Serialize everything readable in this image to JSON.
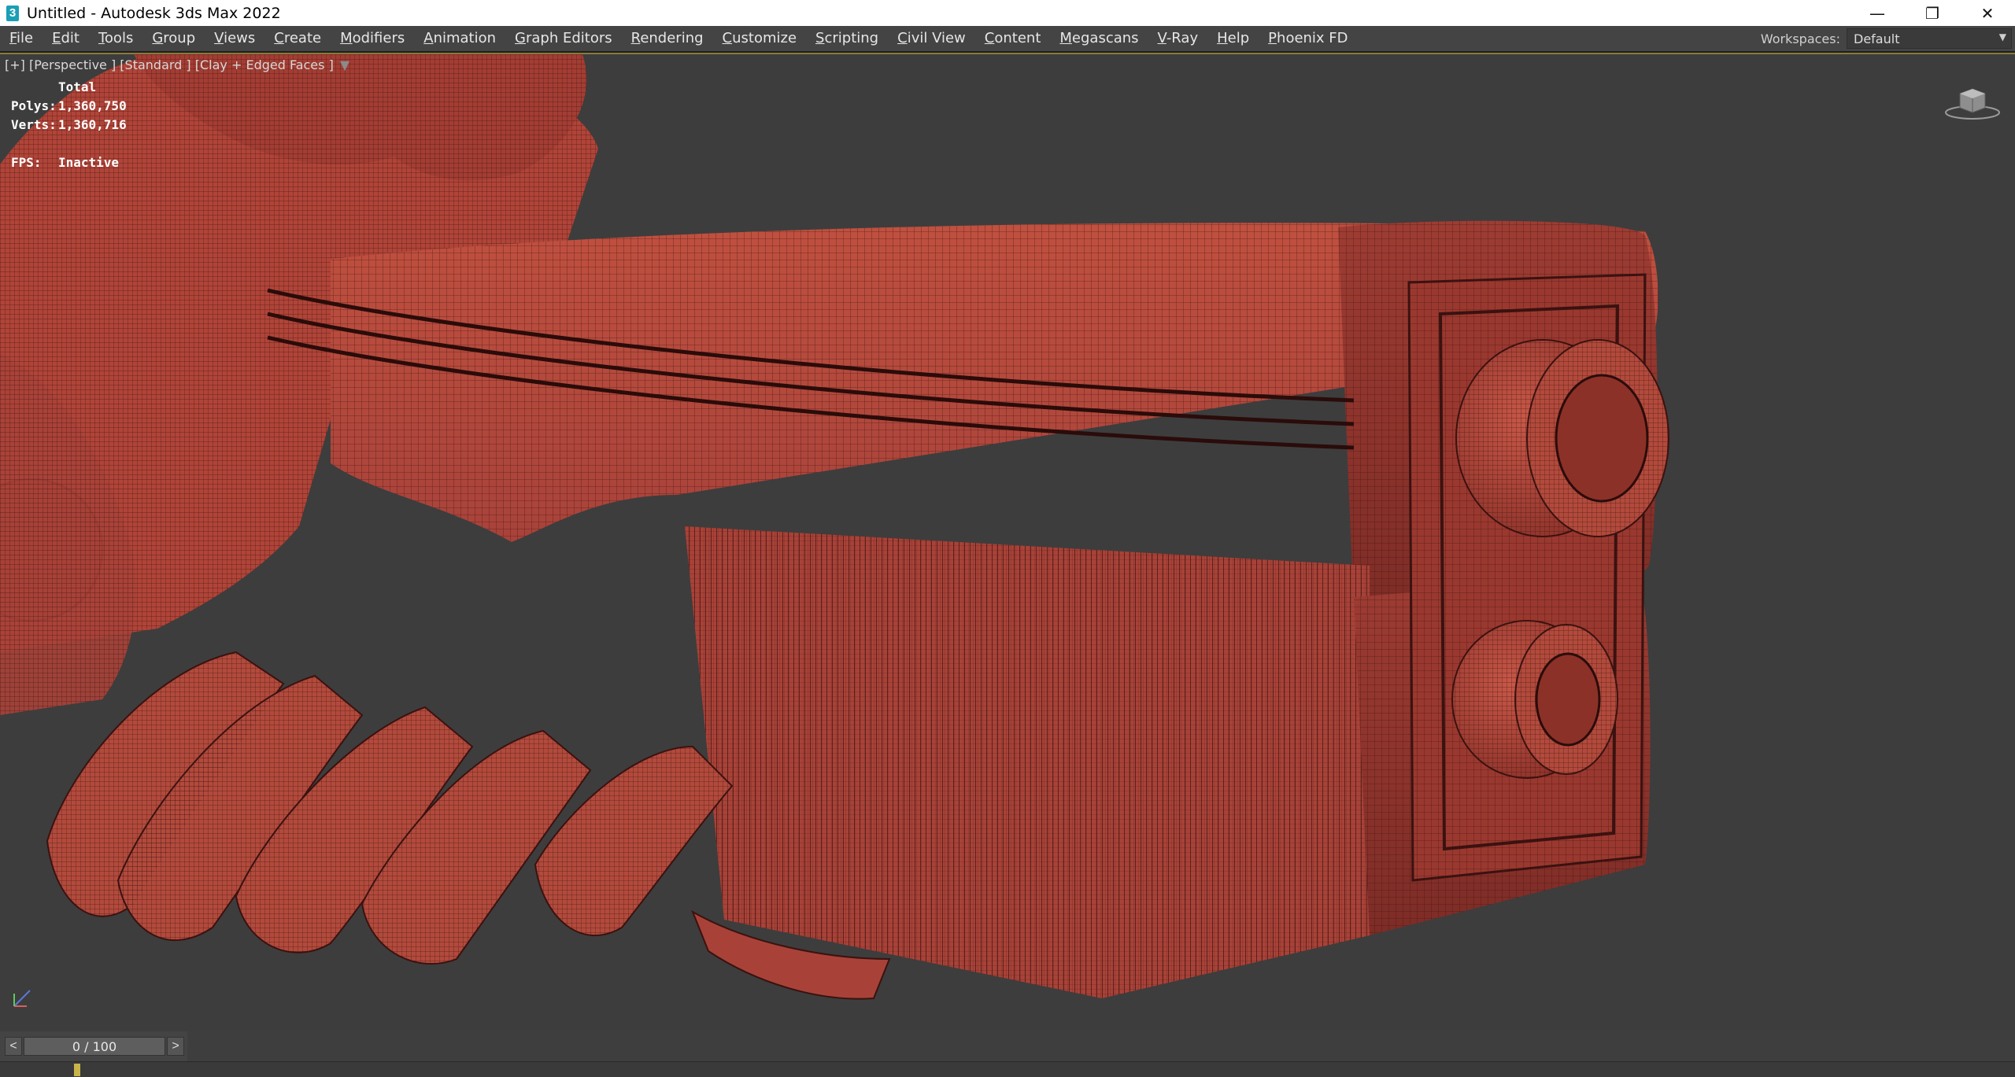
{
  "window": {
    "title": "Untitled - Autodesk 3ds Max 2022",
    "app_icon": "3",
    "minimize_glyph": "—",
    "restore_glyph": "❐",
    "close_glyph": "✕"
  },
  "menu": {
    "items": [
      "File",
      "Edit",
      "Tools",
      "Group",
      "Views",
      "Create",
      "Modifiers",
      "Animation",
      "Graph Editors",
      "Rendering",
      "Customize",
      "Scripting",
      "Civil View",
      "Content",
      "Megascans",
      "V-Ray",
      "Help",
      "Phoenix FD"
    ],
    "workspace_label": "Workspaces:",
    "workspace_value": "Default"
  },
  "viewport": {
    "label": "[+] [Perspective ] [Standard ] [Clay + Edged Faces ]",
    "filter_icon": "funnel-icon",
    "stats": {
      "header": "Total",
      "polys_label": "Polys:",
      "polys_value": "1,360,750",
      "verts_label": "Verts:",
      "verts_value": "1,360,716",
      "fps_label": "FPS:",
      "fps_value": "Inactive"
    },
    "colors": {
      "background": "#3d3d3d",
      "clay": "#b5463c",
      "clay_dark": "#7a2a22",
      "wire": "#3a1210"
    }
  },
  "timeline": {
    "prev_label": "<",
    "frame_display": "0 / 100",
    "next_label": ">"
  }
}
